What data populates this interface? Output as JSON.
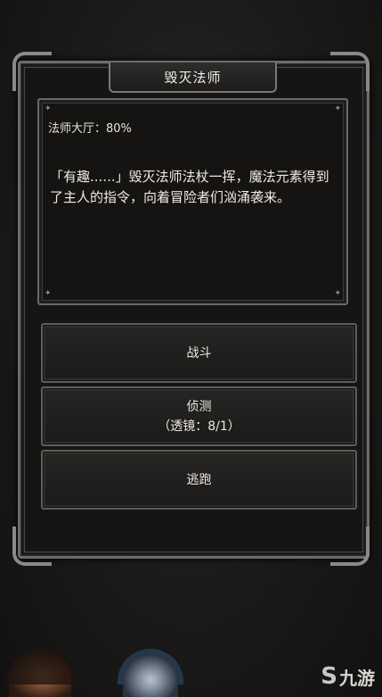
{
  "dialog": {
    "title": "毁灭法师",
    "location": "法师大厅：80%",
    "description": "「有趣......」毁灭法师法杖一挥，魔法元素得到了主人的指令，向着冒险者们汹涌袭来。"
  },
  "actions": {
    "fight": "战斗",
    "scout": "侦测",
    "scout_detail": "（透镜：8/1）",
    "flee": "逃跑"
  },
  "watermark": {
    "mark": "S",
    "text": "九游"
  }
}
